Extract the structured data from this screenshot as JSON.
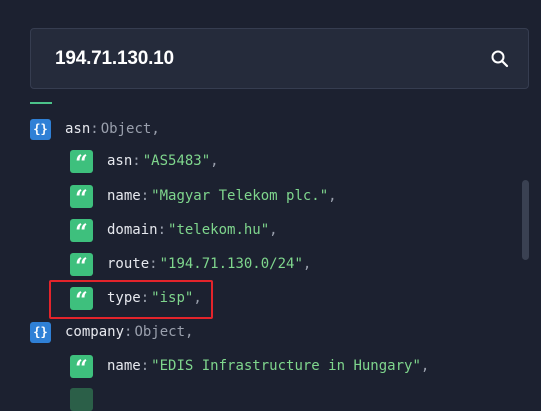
{
  "search": {
    "value": "194.71.130.10"
  },
  "rows": [
    {
      "icon": "{}",
      "key": "asn",
      "colon": ":",
      "value": "Object",
      "comma": ","
    },
    {
      "icon": "“",
      "key": "asn",
      "colon": ":",
      "value": "\"AS5483\"",
      "comma": ","
    },
    {
      "icon": "“",
      "key": "name",
      "colon": ":",
      "value": "\"Magyar Telekom plc.\"",
      "comma": ","
    },
    {
      "icon": "“",
      "key": "domain",
      "colon": ":",
      "value": "\"telekom.hu\"",
      "comma": ","
    },
    {
      "icon": "“",
      "key": "route",
      "colon": ":",
      "value": "\"194.71.130.0/24\"",
      "comma": ","
    },
    {
      "icon": "“",
      "key": "type",
      "colon": ":",
      "value": "\"isp\"",
      "comma": ","
    },
    {
      "icon": "{}",
      "key": "company",
      "colon": ":",
      "value": "Object",
      "comma": ","
    },
    {
      "icon": "“",
      "key": "name",
      "colon": ":",
      "value": "\"EDIS Infrastructure in Hungary\"",
      "comma": ","
    }
  ],
  "colors": {
    "background": "#1c2130",
    "object_icon": "#2f80d6",
    "string_icon": "#3ec07d",
    "string_value": "#7fd68d",
    "highlight": "#e3242b"
  },
  "icons": {
    "search": "search-icon",
    "object": "object-braces-icon",
    "string": "string-quote-icon"
  }
}
